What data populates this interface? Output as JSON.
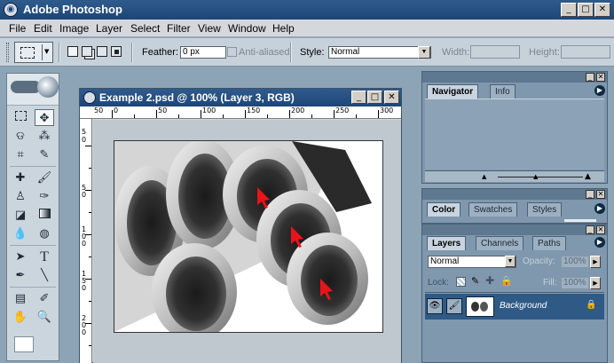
{
  "app": {
    "title": "Adobe Photoshop",
    "icon": "photoshop-eye-icon"
  },
  "window_controls": {
    "minimize": "_",
    "maximize": "□",
    "close": "✕"
  },
  "menu": [
    "File",
    "Edit",
    "Image",
    "Layer",
    "Select",
    "Filter",
    "View",
    "Window",
    "Help"
  ],
  "options": {
    "feather_label": "Feather:",
    "feather_value": "0 px",
    "antialiased_label": "Anti-aliased",
    "style_label": "Style:",
    "style_value": "Normal",
    "width_label": "Width:",
    "height_label": "Height:"
  },
  "document": {
    "title": "Example 2.psd @ 100% (Layer 3, RGB)",
    "ruler_h_labels": [
      "50",
      "0",
      "50",
      "100",
      "150",
      "200",
      "250",
      "300"
    ],
    "ruler_v_labels": [
      "5",
      "0",
      "5",
      "0",
      "1",
      "0",
      "0",
      "1",
      "5",
      "0",
      "2",
      "0",
      "0"
    ]
  },
  "navigator_panel": {
    "tabs": [
      "Navigator",
      "Info"
    ],
    "active": "Navigator"
  },
  "color_panel": {
    "tabs": [
      "Color",
      "Swatches",
      "Styles"
    ],
    "active": "Color"
  },
  "layers_panel": {
    "tabs": [
      "Layers",
      "Channels",
      "Paths"
    ],
    "active": "Layers",
    "blend_mode": "Normal",
    "opacity_label": "Opacity:",
    "opacity_value": "100%",
    "lock_label": "Lock:",
    "fill_label": "Fill:",
    "fill_value": "100%",
    "layers": [
      {
        "name": "Background",
        "locked": true
      }
    ]
  },
  "colors": {
    "title_bar": "#1d4677",
    "panel": "#7f98ae",
    "selected_layer": "#2f5a86",
    "arrow": "#e8141a"
  }
}
